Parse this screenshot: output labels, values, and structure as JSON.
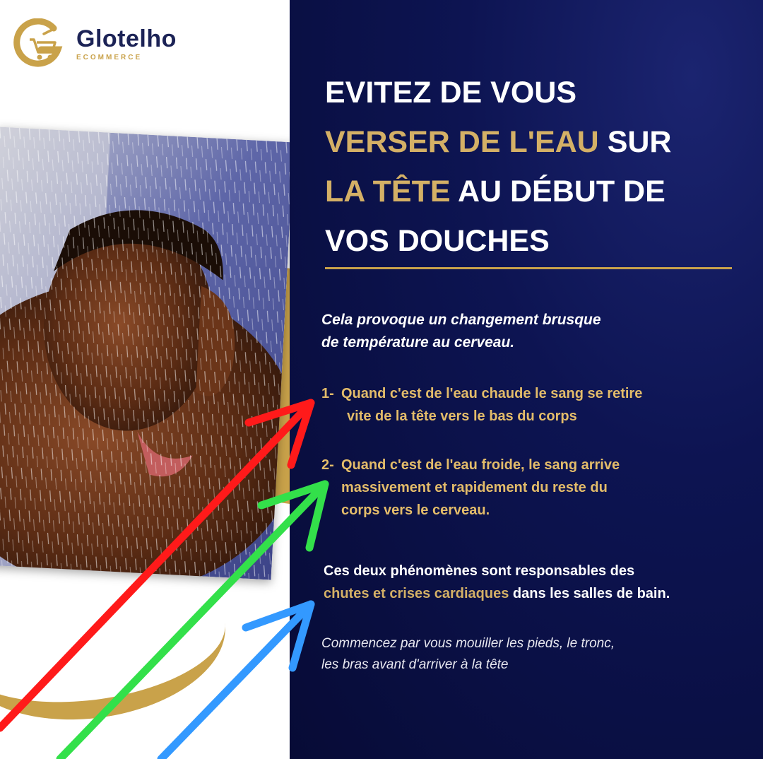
{
  "brand": {
    "name": "Glotelho",
    "tagline": "ECOMMERCE",
    "colors": {
      "gold": "#c9a24a",
      "navy": "#0d1452",
      "text_navy": "#1c2356"
    }
  },
  "headline": {
    "line1": "EVITEZ DE VOUS",
    "line2_highlight": "VERSER DE L'EAU",
    "line2_rest": "SUR",
    "line3_highlight": "LA TÊTE",
    "line3_rest": "AU DÉBUT DE",
    "line4": "VOS DOUCHES"
  },
  "intro": {
    "line1": "Cela provoque un changement brusque",
    "line2": "de température au cerveau."
  },
  "points": [
    {
      "number": "1-",
      "line1": "Quand c'est de l'eau chaude le sang se retire",
      "line2": "vite de la tête vers le bas du corps"
    },
    {
      "number": "2-",
      "line1": "Quand c'est de l'eau froide, le sang arrive",
      "line2": "massivement et rapidement du reste du",
      "line3": "corps vers le cerveau."
    }
  ],
  "consequence": {
    "line1": "Ces deux phénomènes sont responsables des",
    "highlight": "chutes et crises cardiaques",
    "rest": "dans les salles de bain."
  },
  "advice": {
    "line1": "Commencez par vous mouiller les pieds, le tronc,",
    "line2": "les bras avant d'arriver à la tête"
  },
  "annotations": {
    "arrow_colors": {
      "red": "#ff1a1a",
      "green": "#33e04a",
      "blue": "#3399ff"
    }
  }
}
